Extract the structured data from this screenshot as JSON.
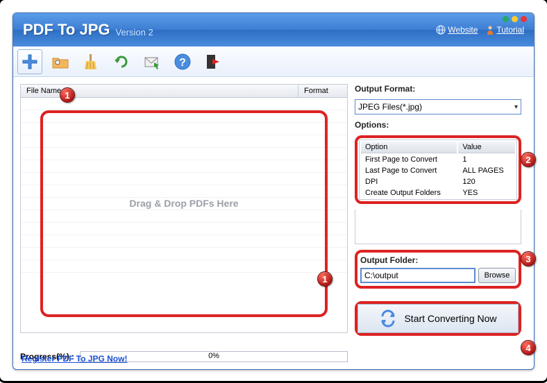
{
  "title": "PDF To JPG",
  "version": "Version 2",
  "links": {
    "website": "Website",
    "tutorial": "Tutorial"
  },
  "fileList": {
    "cols": {
      "name": "File Name",
      "format": "Format"
    },
    "dropText": "Drag & Drop PDFs Here"
  },
  "progress": {
    "label": "Progress(%)  :",
    "value": "0%"
  },
  "register": "Register PDF To JPG Now!",
  "outputFormat": {
    "label": "Output Format:",
    "value": "JPEG Files(*.jpg)"
  },
  "options": {
    "label": "Options:",
    "headers": {
      "option": "Option",
      "value": "Value"
    },
    "rows": [
      {
        "option": "First Page to Convert",
        "value": "1"
      },
      {
        "option": "Last Page to Convert",
        "value": "ALL PAGES"
      },
      {
        "option": "DPI",
        "value": "120"
      },
      {
        "option": "Create Output Folders",
        "value": "YES"
      }
    ]
  },
  "outputFolder": {
    "label": "Output Folder:",
    "value": "C:\\output",
    "browse": "Browse"
  },
  "start": "Start Converting Now",
  "badges": {
    "b1": "1",
    "b2": "2",
    "b3": "3",
    "b4": "4"
  }
}
